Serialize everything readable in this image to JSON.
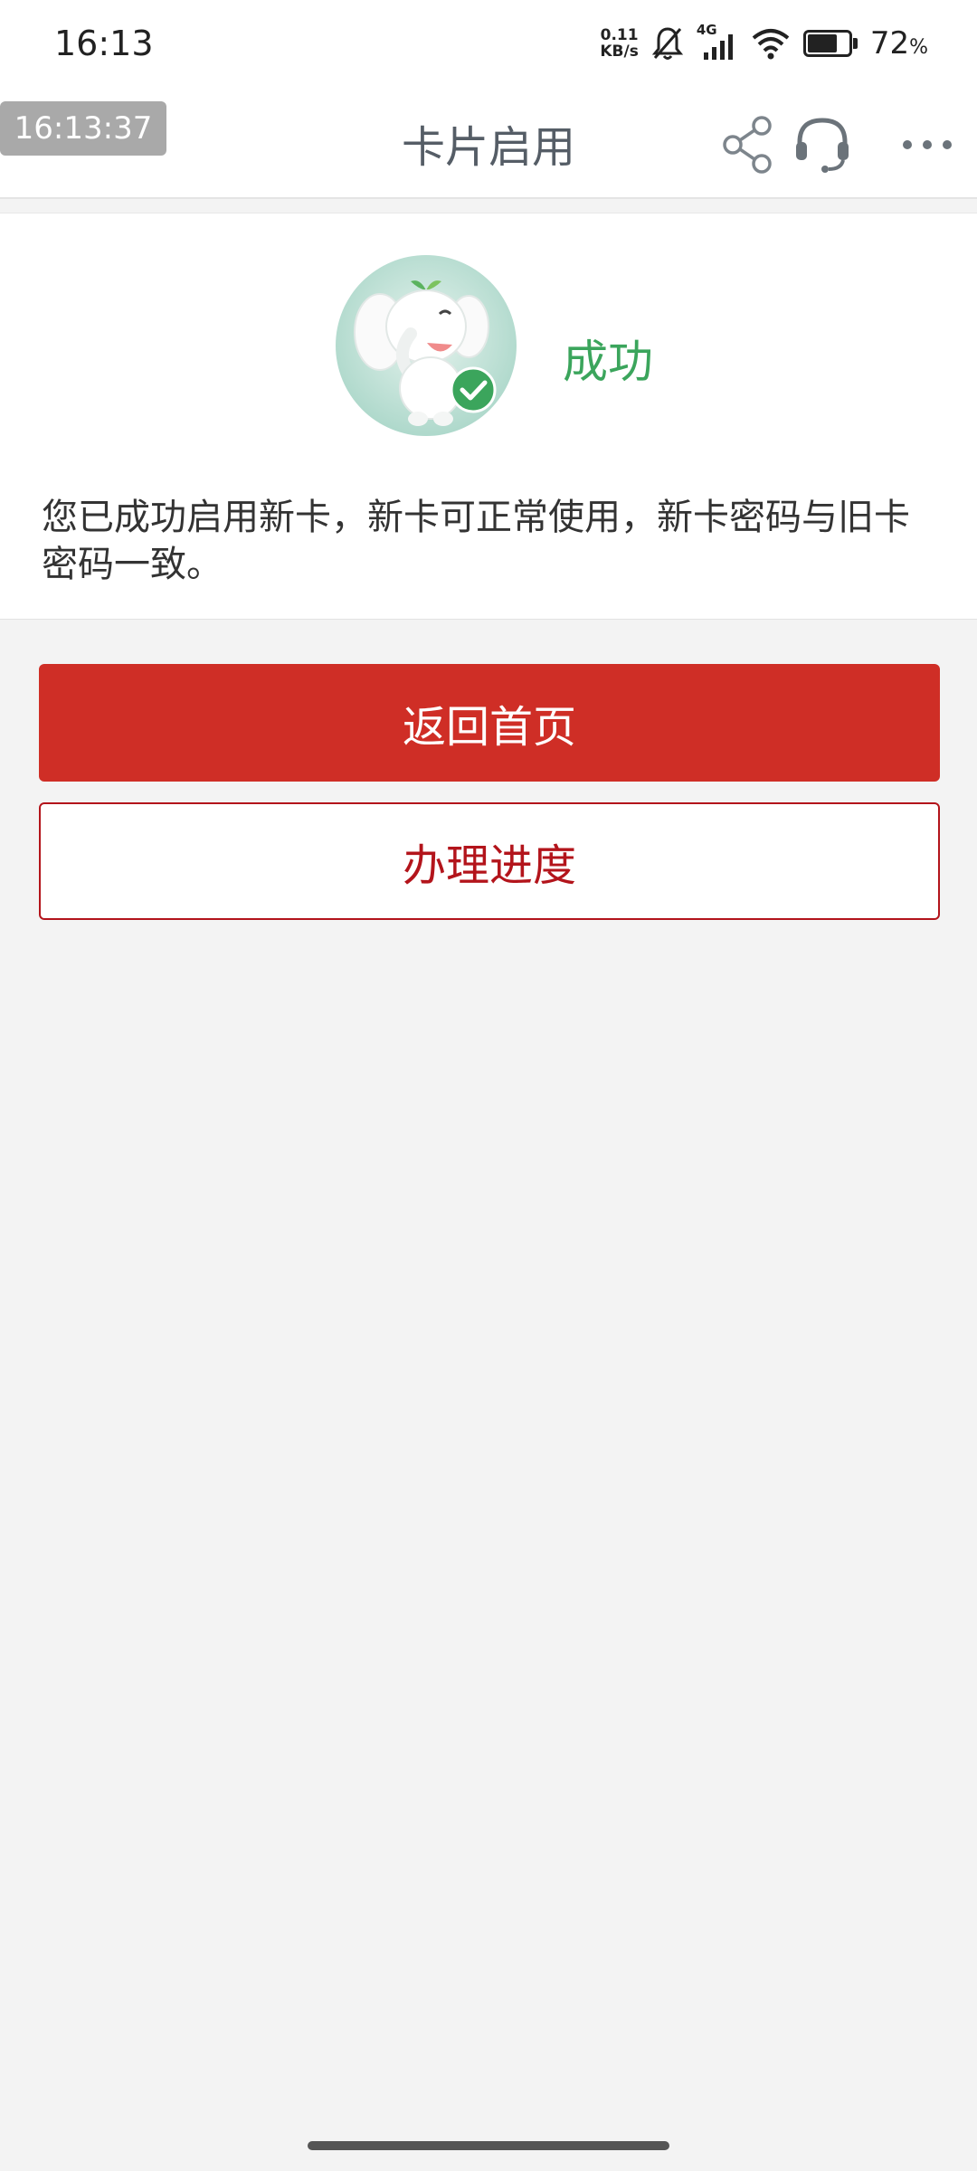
{
  "status_bar": {
    "time": "16:13",
    "net_speed_value": "0.11",
    "net_speed_unit": "KB/s",
    "network": "4G",
    "battery_value": "72",
    "battery_unit": "%",
    "battery_level": 0.72
  },
  "navbar": {
    "clock_chip": "16:13:37",
    "title": "卡片启用",
    "icons": [
      "share-icon",
      "headset-icon",
      "more-icon"
    ]
  },
  "result": {
    "status": "成功",
    "message": "您已成功启用新卡，新卡可正常使用，新卡密码与旧卡密码一致。"
  },
  "actions": {
    "home_label": "返回首页",
    "progress_label": "办理进度"
  },
  "colors": {
    "primary": "#cf2e26",
    "success": "#3ba55c",
    "outline": "#b3141b"
  }
}
